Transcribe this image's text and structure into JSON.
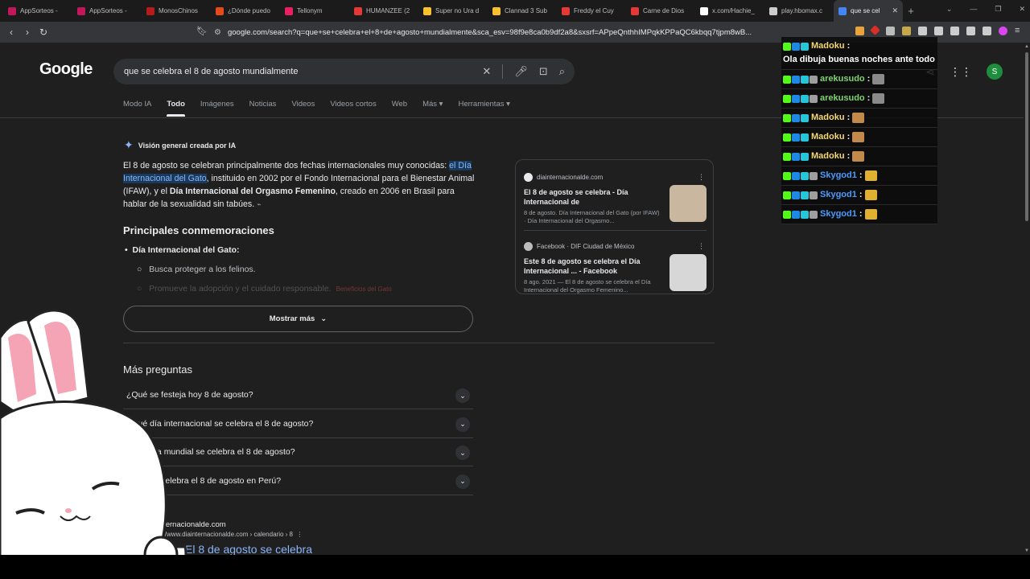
{
  "tabs": [
    {
      "label": "AppSorteos - ",
      "color": "#c2185b"
    },
    {
      "label": "AppSorteos - ",
      "color": "#c2185b"
    },
    {
      "label": "MonosChinos",
      "color": "#b71c1c"
    },
    {
      "label": "¿Dónde puedo",
      "color": "#e64a19"
    },
    {
      "label": "Tellonym",
      "color": "#e91e63"
    },
    {
      "label": "HUMANZEE (2",
      "color": "#e53935"
    },
    {
      "label": "Super no Ura d",
      "color": "#fbc02d"
    },
    {
      "label": "Clannad 3 Sub",
      "color": "#fbc02d"
    },
    {
      "label": "Freddy el Cuy",
      "color": "#e53935"
    },
    {
      "label": "Carne de Dios",
      "color": "#e53935"
    },
    {
      "label": "x.com/Hachie_",
      "color": "#ffffff"
    },
    {
      "label": "play.hbomax.c",
      "color": "#cccccc"
    },
    {
      "label": "que se cel",
      "color": "#4285f4"
    }
  ],
  "newtab": "+",
  "window_controls": [
    "⌄",
    "—",
    "❐",
    "✕"
  ],
  "url": "google.com/search?q=que+se+celebra+el+8+de+agosto+mundialmente&sca_esv=98f9e8ca0b9df2a8&sxsrf=APpeQnthhIMPqkKPPaQC6kbqq7tjpm8wB...",
  "logo": "Google",
  "search": {
    "value": "que se celebra el 8 de agosto mundialmente"
  },
  "avatar_letter": "S",
  "nav_tabs": [
    "Modo IA",
    "Todo",
    "Imágenes",
    "Noticias",
    "Videos",
    "Videos cortos",
    "Web",
    "Más ▾",
    "Herramientas ▾"
  ],
  "ai": {
    "heading": "Visión general creada por IA",
    "p1_a": "El 8 de agosto se celebran principalmente dos fechas internacionales muy conocidas: ",
    "p1_hl": "el Día Internacional del Gato",
    "p1_b": ", instituido en 2002 por el Fondo Internacional para el Bienestar Animal (IFAW), y el ",
    "p1_bold": "Día Internacional del Orgasmo Femenino",
    "p1_c": ", creado en 2006 en Brasil para hablar de la sexualidad sin tabúes.",
    "h2": "Principales conmemoraciones",
    "bullet1": "Día Internacional del Gato:",
    "sub1": "Busca proteger a los felinos.",
    "sub2": "Promueve la adopción y el cuidado responsable.",
    "sub2_extra": "Beneficios del Gato",
    "show_more": "Mostrar más"
  },
  "sources": [
    {
      "site": "diainternacionalde.com",
      "title": "El 8 de agosto se celebra - Día Internacional de",
      "snippet": "8 de agosto. Día Internacional del Gato (por IFAW) · Día Internacional del Orgasmo...",
      "thumb_color": "#c9b7a0"
    },
    {
      "site": "Facebook · DIF Ciudad de México",
      "title": "Este 8 de agosto se celebra el Día Internacional ... - Facebook",
      "snippet": "8 ago. 2021 — El 8 de agosto se celebra el Día Internacional del Orgasmo Femenino...",
      "thumb_color": "#d7d7d7"
    }
  ],
  "more_questions": {
    "title": "Más preguntas",
    "items": [
      "¿Qué se festeja hoy 8 de agosto?",
      "¿Qué día internacional se celebra el 8 de agosto?",
      "¿Qué día mundial se celebra el 8 de agosto?",
      "¿Qué se celebra el 8 de agosto en Perú?"
    ]
  },
  "result": {
    "site": "diainternacionalde.com",
    "url": "https://www.diainternacionalde.com › calendario › 8",
    "title": "El 8 de agosto se celebra"
  },
  "chat": [
    {
      "user": "Madoku",
      "color": "#f5d76e",
      "text": "Ola dibuja buenas noches ante todo",
      "emote": ""
    },
    {
      "user": "arekusudo",
      "color": "#7fd36f",
      "text": "",
      "emote": "#8a8a8a"
    },
    {
      "user": "arekusudo",
      "color": "#7fd36f",
      "text": "",
      "emote": "#8a8a8a"
    },
    {
      "user": "Madoku",
      "color": "#f5d76e",
      "text": "",
      "emote": "#c28a4a"
    },
    {
      "user": "Madoku",
      "color": "#f5d76e",
      "text": "",
      "emote": "#c28a4a"
    },
    {
      "user": "Madoku",
      "color": "#f5d76e",
      "text": "",
      "emote": "#c28a4a"
    },
    {
      "user": "Skygod1",
      "color": "#4a9cff",
      "text": "",
      "emote": "#e0b030"
    },
    {
      "user": "Skygod1",
      "color": "#4a9cff",
      "text": "",
      "emote": "#e0b030"
    },
    {
      "user": "Skygod1",
      "color": "#4a9cff",
      "text": "",
      "emote": "#e0b030"
    }
  ]
}
